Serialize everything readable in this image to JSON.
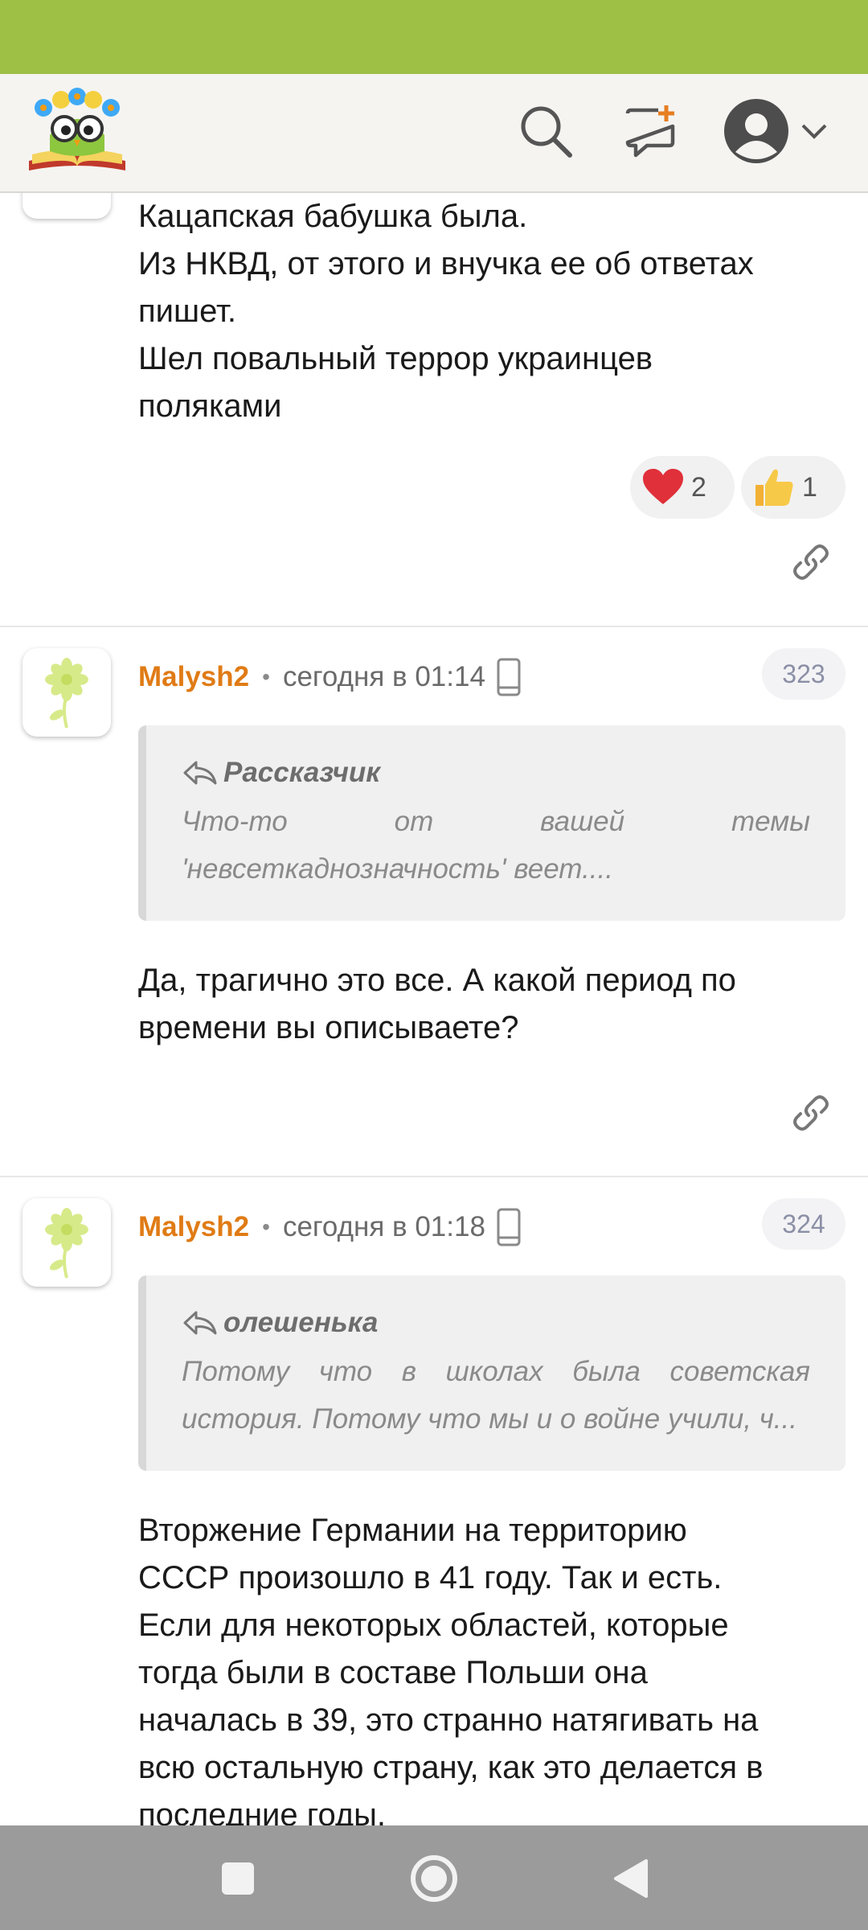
{
  "colors": {
    "status_bar": "#9dc045",
    "app_bar": "#f5f4f1",
    "author": "#e07b15",
    "nav_bar": "#9b9b9b"
  },
  "toolbar": {
    "logo": "owl-reading-book-logo",
    "search_icon": "search-icon",
    "new_message_icon": "chat-plus-icon",
    "profile_icon": "user-avatar-icon",
    "dropdown_icon": "chevron-down-icon"
  },
  "post0": {
    "lines": [
      "Кацапская бабушка была.",
      "Из НКВД, от этого и внучка ее об ответах",
      "пишет.",
      "Шел повальный террор украинцев",
      "поляками"
    ],
    "reactions": [
      {
        "icon": "heart-icon",
        "count": "2"
      },
      {
        "icon": "thumbs-up-icon",
        "count": "1"
      }
    ]
  },
  "comments": [
    {
      "author": "Malysh2",
      "separator": "•",
      "time": "сегодня в 01:14",
      "number": "323",
      "quote_author": "Рассказчик",
      "quote_text": "Что-то от вашей темы 'невсеткаднозначность' веет....",
      "lines": [
        "Да, трагично это все. А какой период по",
        "времени вы описываете?"
      ]
    },
    {
      "author": "Malysh2",
      "separator": "•",
      "time": "сегодня в 01:18",
      "number": "324",
      "quote_author": "олешенька",
      "quote_text": "Потому что в школах была советская история. Потому что мы и о войне учили, ч...",
      "lines": [
        "Вторжение Германии на территорию",
        "СССР произошло в 41 году. Так и есть.",
        "Если для некоторых областей, которые",
        "тогда были в составе Польши она",
        "началась в 39, это странно натягивать на",
        "всю остальную страну, как это делается в",
        "последние годы."
      ]
    }
  ],
  "navigation": {
    "recents": "square-icon",
    "home": "circle-icon",
    "back": "triangle-back-icon"
  }
}
